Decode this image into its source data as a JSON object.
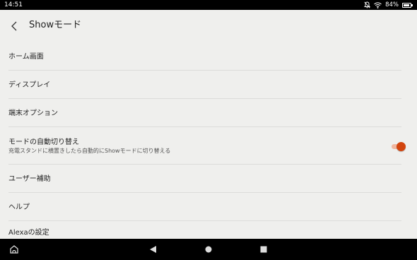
{
  "status_bar": {
    "time": "14:51",
    "battery_percent_text": "84%",
    "battery_level": 0.84,
    "icons": [
      "notifications-off-icon",
      "wifi-icon",
      "battery-icon"
    ]
  },
  "header": {
    "title": "Showモード",
    "back_icon": "back-arrow-icon"
  },
  "settings": {
    "items": [
      {
        "label": "ホーム画面"
      },
      {
        "label": "ディスプレイ"
      },
      {
        "label": "端末オプション"
      },
      {
        "label": "モードの自動切り替え",
        "description": "充電スタンドに横置きしたら自動的にShowモードに切り替える",
        "toggle_on": true
      },
      {
        "label": "ユーザー補助"
      },
      {
        "label": "ヘルプ"
      },
      {
        "label": "Alexaの設定"
      }
    ]
  },
  "colors": {
    "accent": "#d2440e",
    "toggle_track": "#f0b69f",
    "background": "#efefed",
    "status_bar": "#000000"
  },
  "nav_bar": {
    "icons": [
      "alexa-home-icon",
      "back-triangle-icon",
      "home-circle-icon",
      "recents-square-icon"
    ]
  }
}
